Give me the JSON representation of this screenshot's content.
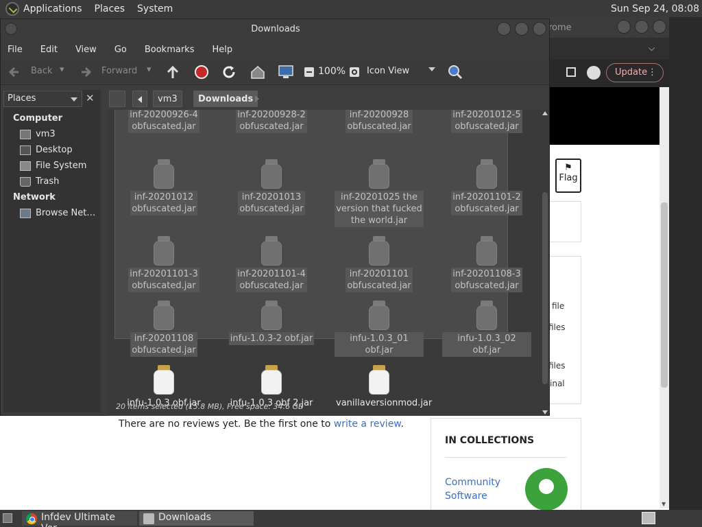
{
  "top_panel": {
    "menus": [
      "Applications",
      "Places",
      "System"
    ],
    "clock": "Sun Sep 24, 08:08"
  },
  "browser": {
    "title": "rome",
    "update_label": "Update",
    "flag_label": "Flag",
    "side_fragments": [
      "file",
      "files",
      "files",
      "inal"
    ],
    "no_reviews_text": "There are no reviews yet. Be the first one to",
    "write_review_link": "write a review",
    "no_reviews_end": ".",
    "collections_title": "IN COLLECTIONS",
    "collection_link": "Community Software"
  },
  "file_manager": {
    "title": "Downloads",
    "menu": [
      "File",
      "Edit",
      "View",
      "Go",
      "Bookmarks",
      "Help"
    ],
    "toolbar": {
      "back": "Back",
      "forward": "Forward",
      "zoom": "100%",
      "view_mode": "Icon View"
    },
    "sidebar": {
      "selector": "Places",
      "groups": [
        {
          "title": "Computer",
          "items": [
            "vm3",
            "Desktop",
            "File System",
            "Trash"
          ]
        },
        {
          "title": "Network",
          "items": [
            "Browse Net…"
          ]
        }
      ]
    },
    "path": [
      "vm3",
      "Downloads"
    ],
    "files_selected": [
      [
        "inf-20200926-4",
        "obfuscated.jar"
      ],
      [
        "inf-20200928-2",
        "obfuscated.jar"
      ],
      [
        "inf-20200928",
        "obfuscated.jar"
      ],
      [
        "inf-20201012-5",
        "obfuscated.jar"
      ],
      [
        "inf-20201012",
        "obfuscated.jar"
      ],
      [
        "inf-20201013",
        "obfuscated.jar"
      ],
      [
        "inf-20201025 the",
        "version that fucked",
        "the world.jar"
      ],
      [
        "inf-20201101-2",
        "obfuscated.jar"
      ],
      [
        "inf-20201101-3",
        "obfuscated.jar"
      ],
      [
        "inf-20201101-4",
        "obfuscated.jar"
      ],
      [
        "inf-20201101",
        "obfuscated.jar"
      ],
      [
        "inf-20201108-3",
        "obfuscated.jar"
      ],
      [
        "inf-20201108",
        "obfuscated.jar"
      ],
      [
        "infu-1.0.3-2 obf.jar"
      ],
      [
        "infu-1.0.3_01 obf.jar"
      ],
      [
        "infu-1.0.3_02 obf.jar"
      ]
    ],
    "files_unselected": [
      [
        "infu-1.0.3 obf.jar"
      ],
      [
        "infu-1.0.3 obf 2.jar"
      ],
      [
        "vanillaversionmod.jar"
      ]
    ],
    "status": "20 items selected (15.8 MB), Free space: 34.6 GB"
  },
  "taskbar": {
    "tasks": [
      "Infdev Ultimate Ver…",
      "Downloads"
    ]
  }
}
